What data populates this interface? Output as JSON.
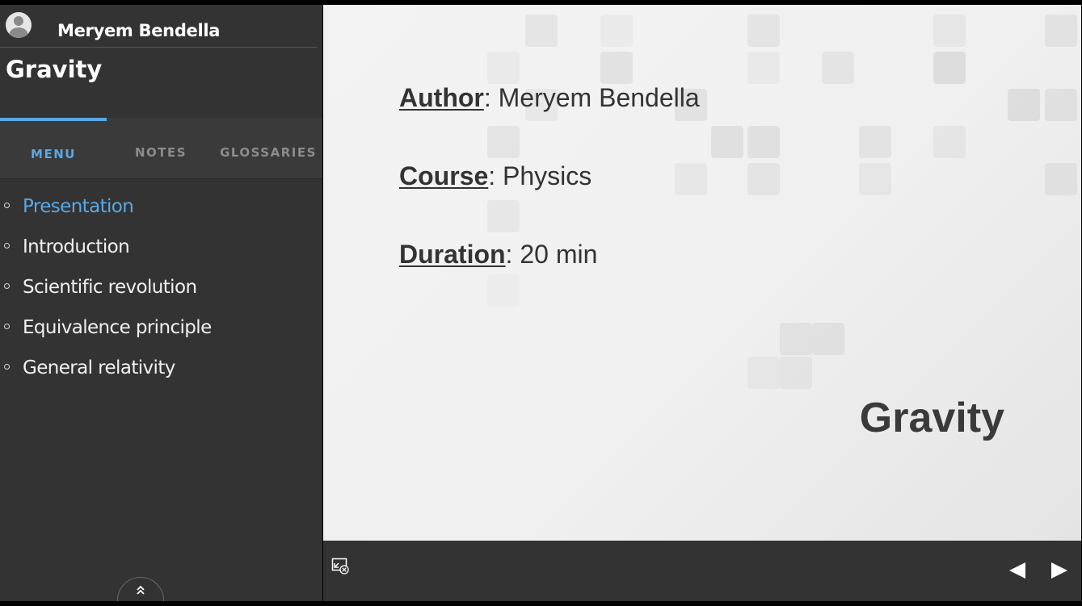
{
  "sidebar": {
    "user_name": "Meryem Bendella",
    "course_title": "Gravity",
    "tabs": [
      {
        "label": "MENU",
        "active": true
      },
      {
        "label": "NOTES",
        "active": false
      },
      {
        "label": "GLOSSARIES",
        "active": false
      }
    ],
    "menu_items": [
      {
        "label": "Presentation",
        "active": true
      },
      {
        "label": "Introduction",
        "active": false
      },
      {
        "label": "Scientific revolution",
        "active": false
      },
      {
        "label": "Equivalence principle",
        "active": false
      },
      {
        "label": "General relativity",
        "active": false
      }
    ],
    "collapse_icon": "double-chevron-up-icon"
  },
  "slide": {
    "author_key": "Author",
    "author_value": ": Meryem Bendella",
    "course_key": "Course",
    "course_value": ": Physics",
    "duration_key": "Duration",
    "duration_value": ": 20 min",
    "title": "Gravity"
  },
  "controls": {
    "fullscreen_icon": "exit-fullscreen-icon",
    "prev_icon": "triangle-left-icon",
    "next_icon": "triangle-right-icon"
  },
  "colors": {
    "accent": "#5aa8e6",
    "sidebar_bg": "#333333",
    "slide_text": "#333333"
  }
}
